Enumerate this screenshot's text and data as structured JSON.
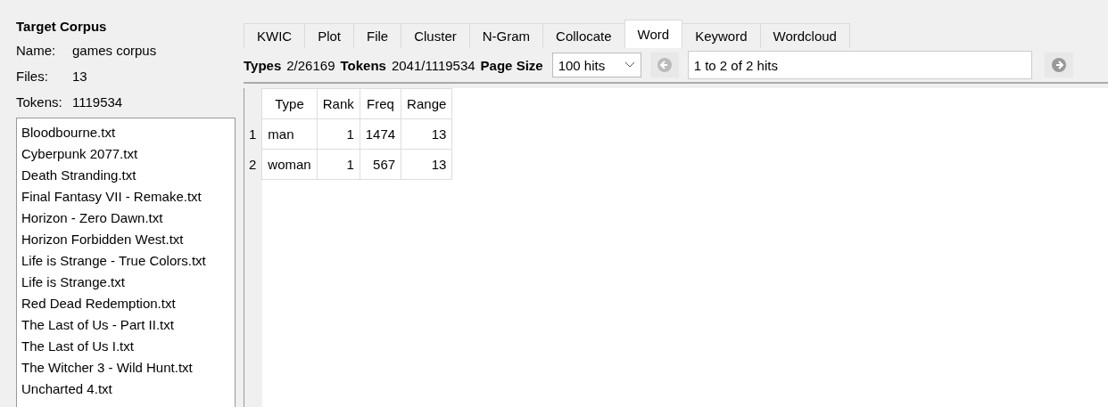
{
  "corpus": {
    "title": "Target Corpus",
    "fields": [
      {
        "label": "Name:",
        "value": "games corpus"
      },
      {
        "label": "Files:",
        "value": "13"
      },
      {
        "label": "Tokens:",
        "value": "1119534"
      }
    ],
    "files": [
      "Bloodbourne.txt",
      "Cyberpunk 2077.txt",
      "Death Stranding.txt",
      "Final Fantasy VII - Remake.txt",
      "Horizon - Zero Dawn.txt",
      "Horizon Forbidden West.txt",
      "Life is Strange - True Colors.txt",
      "Life is Strange.txt",
      "Red Dead Redemption.txt",
      "The Last of Us - Part II.txt",
      "The Last of Us I.txt",
      "The Witcher 3 - Wild Hunt.txt",
      "Uncharted 4.txt"
    ]
  },
  "tabs": [
    {
      "label": "KWIC",
      "selected": false
    },
    {
      "label": "Plot",
      "selected": false
    },
    {
      "label": "File",
      "selected": false
    },
    {
      "label": "Cluster",
      "selected": false
    },
    {
      "label": "N-Gram",
      "selected": false
    },
    {
      "label": "Collocate",
      "selected": false
    },
    {
      "label": "Word",
      "selected": true
    },
    {
      "label": "Keyword",
      "selected": false
    },
    {
      "label": "Wordcloud",
      "selected": false
    }
  ],
  "toolbar": {
    "stats": [
      {
        "label": "Types",
        "value": "2/26169"
      },
      {
        "label": "Tokens",
        "value": "2041/1119534"
      }
    ],
    "page_size_label": "Page Size",
    "page_size": "100 hits",
    "hits": "1 to 2 of 2 hits"
  },
  "table": {
    "columns": [
      "Type",
      "Rank",
      "Freq",
      "Range"
    ],
    "rows": [
      {
        "index": "1",
        "cells": [
          "man",
          "1",
          "1474",
          "13"
        ]
      },
      {
        "index": "2",
        "cells": [
          "woman",
          "1",
          "567",
          "13"
        ]
      }
    ]
  }
}
